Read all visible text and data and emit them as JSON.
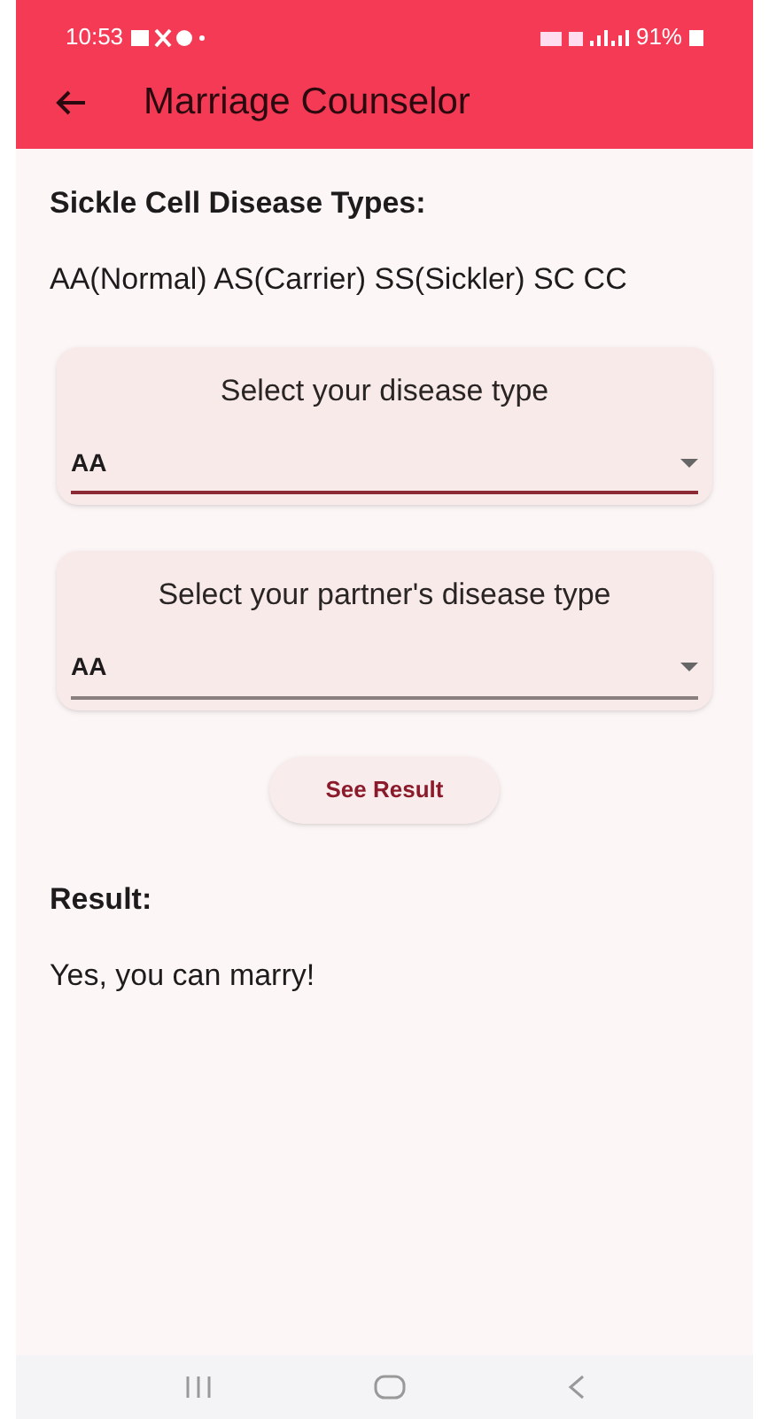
{
  "status_bar": {
    "time": "10:53",
    "battery": "91%"
  },
  "app_bar": {
    "title": "Marriage Counselor"
  },
  "types_heading": "Sickle Cell Disease Types:",
  "types_text": "AA(Normal) AS(Carrier) SS(Sickler) SC CC",
  "dropdowns": [
    {
      "label": "Select your disease type",
      "value": "AA",
      "focused": true
    },
    {
      "label": "Select your partner's disease type",
      "value": "AA",
      "focused": false
    }
  ],
  "button": "See Result",
  "result_heading": "Result:",
  "result_text": "Yes, you can marry!"
}
